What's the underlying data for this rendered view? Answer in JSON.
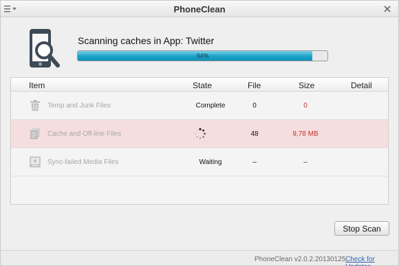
{
  "window": {
    "title": "PhoneClean"
  },
  "scan": {
    "status_text": "Scanning caches in App: Twitter",
    "progress_percent": 94,
    "progress_label": "94%"
  },
  "table": {
    "headers": {
      "item": "Item",
      "state": "State",
      "file": "File",
      "size": "Size",
      "detail": "Detail"
    },
    "rows": [
      {
        "label": "Temp and Junk Files",
        "icon": "trash-icon",
        "state": "Complete",
        "file": "0",
        "size": "0",
        "active": false
      },
      {
        "label": "Cache and Off-line Files",
        "icon": "document-stack-icon",
        "state": "",
        "file": "48",
        "size": "9,78 MB",
        "active": true
      },
      {
        "label": "Sync-failed Media Files",
        "icon": "media-device-icon",
        "state": "Waiting",
        "file": "–",
        "size": "–",
        "active": false
      }
    ]
  },
  "actions": {
    "stop_label": "Stop Scan"
  },
  "footer": {
    "version": "PhoneClean v2.0.2.20130125",
    "update_link": "Check for Updates"
  },
  "colors": {
    "progress_fill": "#1aa3c8",
    "active_row": "#f6dede",
    "size_red": "#c23030",
    "link": "#2f63b3"
  }
}
